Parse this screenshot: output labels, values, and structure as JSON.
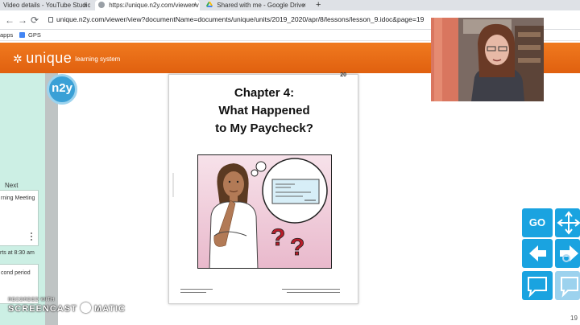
{
  "browser": {
    "tabs": [
      {
        "title": "Video details - YouTube Studio",
        "active": false
      },
      {
        "title": "https://unique.n2y.com/viewer/v",
        "active": true
      },
      {
        "title": "Shared with me - Google Drive",
        "active": false
      }
    ],
    "new_tab_label": "+",
    "close_label": "×",
    "url": "unique.n2y.com/viewer/view?documentName=documents/unique/units/2019_2020/apr/8/lessons/lesson_9.idoc&page=19",
    "bookmarks": [
      {
        "label": "apps"
      },
      {
        "label": "GPS"
      }
    ]
  },
  "app": {
    "brand": "unique",
    "brand_sub": "learning system",
    "brand_color": "#e8701a"
  },
  "left_panel": {
    "n2y_logo": "n2y",
    "next_label": "Next",
    "items": [
      {
        "text": "rning Meeting"
      },
      {
        "text": "rts at 8:30 am"
      },
      {
        "text": "cond period"
      }
    ]
  },
  "document": {
    "page_marker": "20",
    "chapter_line1": "Chapter 4:",
    "chapter_line2": "What Happened",
    "chapter_line3": "to My Paycheck?"
  },
  "toolbar": {
    "go_label": "GO",
    "accent": "#1aa3e0"
  },
  "watermark": {
    "line1": "RECORDED WITH",
    "line2_a": "SCREENCAST",
    "line2_b": "MATIC"
  },
  "footer": {
    "page_number": "19"
  }
}
